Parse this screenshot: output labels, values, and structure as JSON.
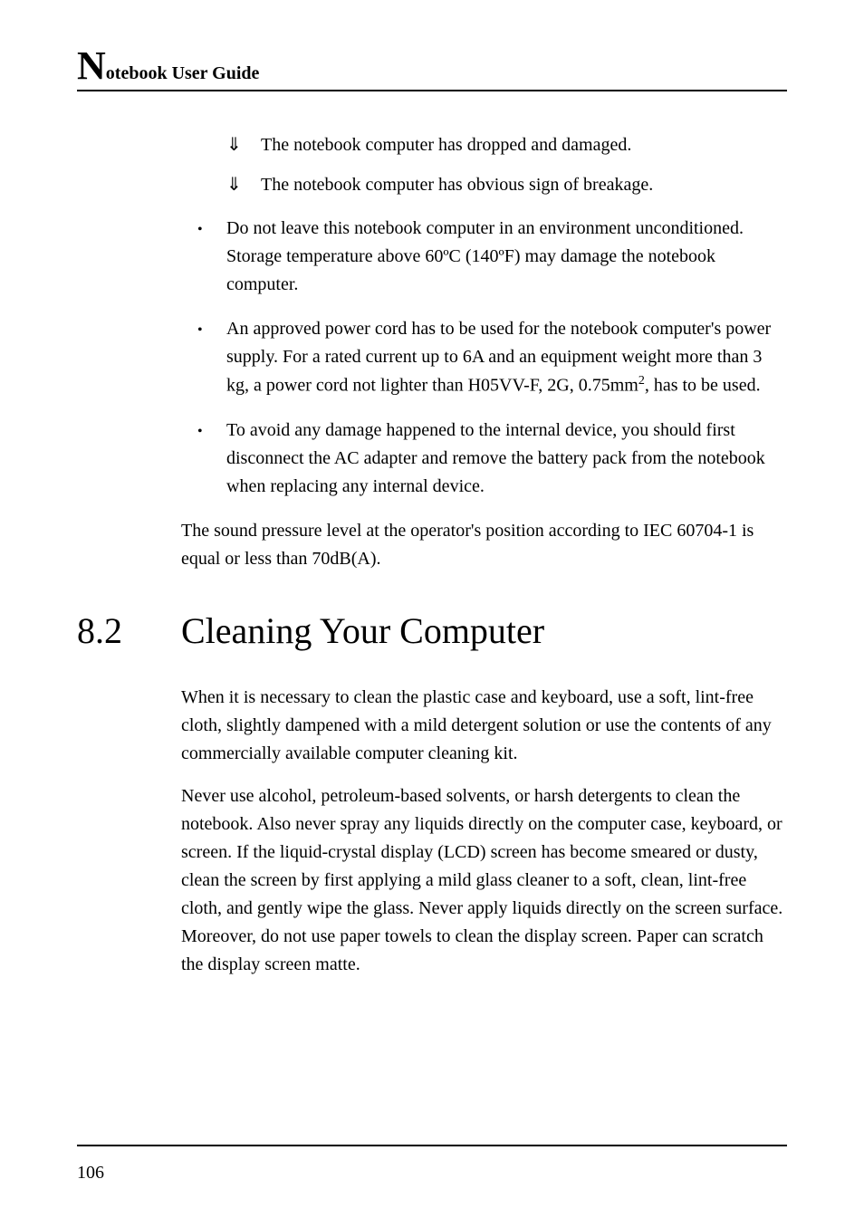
{
  "header": {
    "dropcap": "N",
    "rest": "otebook User Guide"
  },
  "sub_bullets": [
    "The notebook computer has dropped and damaged.",
    "The notebook computer has obvious sign of breakage."
  ],
  "bullets": [
    "Do not leave this notebook computer in an environment unconditioned. Storage temperature above 60ºC (140ºF) may damage the notebook computer.",
    "An approved power cord has to be used for the notebook computer's power supply.  For a rated current up to 6A and an equipment weight more than 3 kg, a power cord not lighter than H05VV-F, 2G, 0.75mm², has to be used.",
    "To avoid any damage happened to the internal device, you should first disconnect the AC adapter and remove the battery pack from the notebook when replacing any internal device."
  ],
  "para_after_bullets": "The sound pressure level at the operator's position according to IEC 60704-1 is equal or less than 70dB(A).",
  "section": {
    "number": "8.2",
    "title": "Cleaning Your Computer"
  },
  "paras": [
    "When it is necessary to clean the plastic case and keyboard, use a soft, lint-free cloth, slightly dampened with a mild detergent solution or use the contents of any commercially available computer cleaning kit.",
    "Never use alcohol, petroleum-based solvents, or harsh detergents to clean the notebook. Also never spray any liquids directly on the computer case, keyboard, or screen. If the liquid-crystal display (LCD) screen has become smeared or dusty, clean the screen by first applying a mild glass cleaner to a soft, clean, lint-free cloth, and gently wipe the glass. Never apply liquids directly on the screen surface. Moreover, do not use paper towels to clean the display screen. Paper can scratch the display screen matte."
  ],
  "page_number": "106",
  "symbols": {
    "down_arrow": "⇓",
    "bullet_dot": "•"
  }
}
